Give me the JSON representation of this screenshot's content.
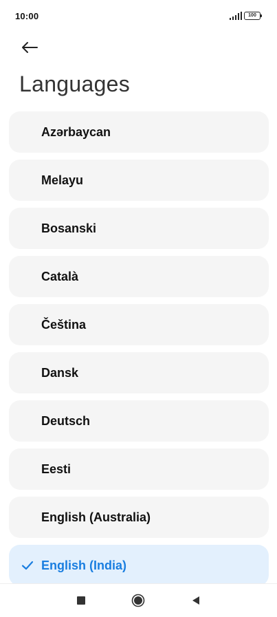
{
  "status_bar": {
    "time": "10:00",
    "battery_level": "100",
    "icons": [
      "signal-icon",
      "battery-icon"
    ]
  },
  "header": {
    "back_icon": "arrow-left-icon",
    "title": "Languages"
  },
  "languages": [
    {
      "label": "Azərbaycan",
      "selected": false
    },
    {
      "label": "Melayu",
      "selected": false
    },
    {
      "label": "Bosanski",
      "selected": false
    },
    {
      "label": "Català",
      "selected": false
    },
    {
      "label": "Čeština",
      "selected": false
    },
    {
      "label": "Dansk",
      "selected": false
    },
    {
      "label": "Deutsch",
      "selected": false
    },
    {
      "label": "Eesti",
      "selected": false
    },
    {
      "label": "English (Australia)",
      "selected": false
    },
    {
      "label": "English (India)",
      "selected": true
    }
  ],
  "colors": {
    "accent": "#1a7ee0",
    "item_background": "#f5f5f5",
    "selected_background": "#e3f0fd"
  },
  "nav_bar": {
    "icons": [
      "recents-square-icon",
      "home-circle-icon",
      "back-triangle-icon"
    ]
  }
}
